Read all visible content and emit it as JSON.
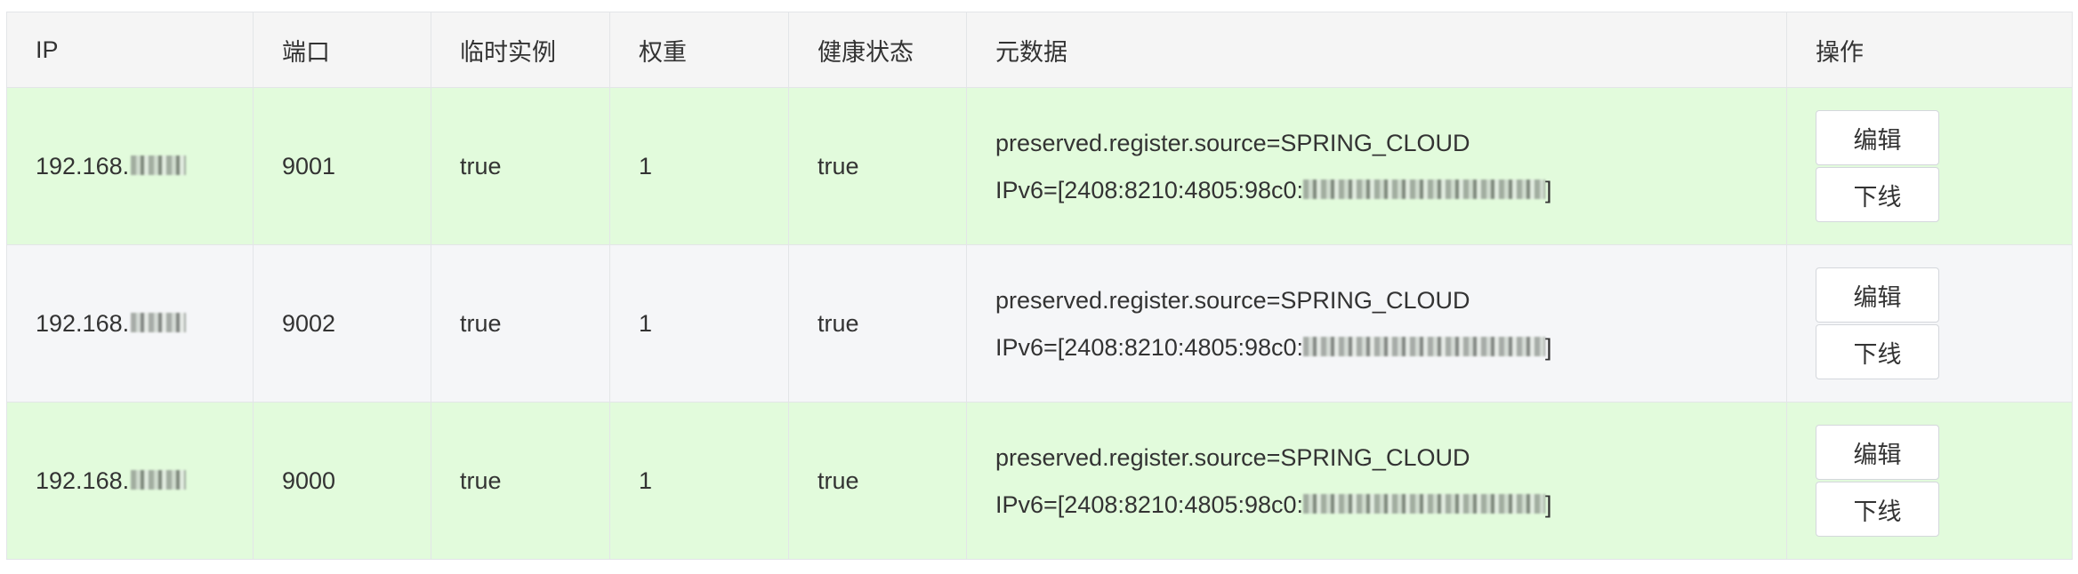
{
  "table": {
    "headers": [
      "IP",
      "端口",
      "临时实例",
      "权重",
      "健康状态",
      "元数据",
      "操作"
    ],
    "rows": [
      {
        "ip_prefix": "192.168.",
        "port": "9001",
        "ephemeral": "true",
        "weight": "1",
        "healthy": "true",
        "metadata_line1": "preserved.register.source=SPRING_CLOUD",
        "metadata_line2_prefix": "IPv6=[2408:8210:4805:98c0:",
        "metadata_line2_suffix": "]"
      },
      {
        "ip_prefix": "192.168.",
        "port": "9002",
        "ephemeral": "true",
        "weight": "1",
        "healthy": "true",
        "metadata_line1": "preserved.register.source=SPRING_CLOUD",
        "metadata_line2_prefix": "IPv6=[2408:8210:4805:98c0:",
        "metadata_line2_suffix": "]"
      },
      {
        "ip_prefix": "192.168.",
        "port": "9000",
        "ephemeral": "true",
        "weight": "1",
        "healthy": "true",
        "metadata_line1": "preserved.register.source=SPRING_CLOUD",
        "metadata_line2_prefix": "IPv6=[2408:8210:4805:98c0:",
        "metadata_line2_suffix": "]"
      }
    ],
    "actions": {
      "edit_label": "编辑",
      "offline_label": "下线"
    }
  },
  "colors": {
    "row_healthy_bg": "#e2fbdc",
    "row_alt_bg": "#f5f6f8",
    "header_bg": "#f5f5f5",
    "border": "#e3e5e8"
  }
}
